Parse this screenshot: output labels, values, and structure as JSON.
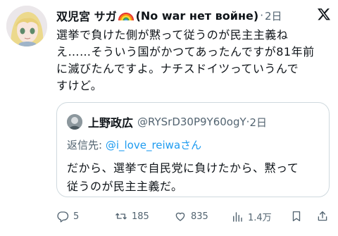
{
  "post": {
    "author_name": "双児宮 サガ",
    "author_tag": "(No war нет войне)",
    "separator": "·",
    "time": "2日",
    "lines": [
      "選挙で負けた側が黙って従うのが民主主義ね",
      "え……そういう国がかつてあったんですが81年前",
      "に滅びたんですよ。ナチスドイツっていうんで",
      "すけど。"
    ]
  },
  "quote": {
    "name": "上野政広",
    "handle": "@RYSrD30P9Y60ogY",
    "separator": "·",
    "time": "2日",
    "reply_label": "返信先: ",
    "reply_mention": "@i_love_reiwa",
    "reply_suffix": "さん",
    "lines": [
      "だから、選挙で自民党に負けたから、黙って",
      "従うのが民主主義だ。"
    ]
  },
  "actions": {
    "replies": "5",
    "reposts": "185",
    "likes": "835",
    "views": "1.4万"
  },
  "colors": {
    "text": "#0f1419",
    "secondary": "#536471",
    "mention": "#1d9bf0",
    "border": "#cfd9de"
  },
  "icons": [
    "rainbow-emoji-icon",
    "x-logo-icon",
    "reply-icon",
    "repost-icon",
    "like-icon",
    "views-icon",
    "bookmark-icon",
    "share-icon"
  ]
}
